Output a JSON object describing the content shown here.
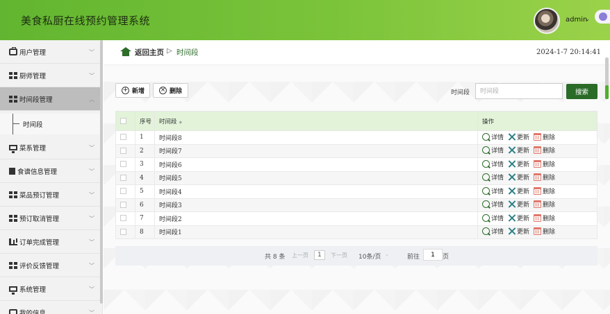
{
  "header": {
    "title": "美食私厨在线预约管理系统",
    "user_name": "admin",
    "caret": "⌄"
  },
  "sidebar": {
    "items": [
      {
        "label": "用户管理",
        "icon": "briefcase-icon",
        "expanded": false
      },
      {
        "label": "厨师管理",
        "icon": "grid-icon",
        "expanded": false
      },
      {
        "label": "时间段管理",
        "icon": "grid-icon",
        "expanded": true
      },
      {
        "label": "菜系管理",
        "icon": "monitor-icon",
        "expanded": false
      },
      {
        "label": "食谱信息管理",
        "icon": "document-icon",
        "expanded": false
      },
      {
        "label": "菜品预订管理",
        "icon": "grid-icon",
        "expanded": false
      },
      {
        "label": "预订取消管理",
        "icon": "grid-icon",
        "expanded": false
      },
      {
        "label": "订单完成管理",
        "icon": "chart-icon",
        "expanded": false
      },
      {
        "label": "评价反馈管理",
        "icon": "grid-icon",
        "expanded": false
      },
      {
        "label": "系统管理",
        "icon": "monitor-icon",
        "expanded": false
      },
      {
        "label": "我的信息",
        "icon": "user-icon",
        "expanded": false
      }
    ],
    "sub_item": "时间段"
  },
  "breadcrumb": {
    "home": "返回主页",
    "separator": "▷",
    "current": "时间段"
  },
  "datetime": "2024-1-7 20:14:41",
  "toolbar": {
    "add_label": "新增",
    "delete_label": "删除",
    "search_label": "时间段",
    "search_placeholder": "时间段",
    "search_button": "搜索"
  },
  "table": {
    "headers": [
      "序号",
      "时间段",
      "操作"
    ],
    "rows": [
      {
        "no": "1",
        "period": "时间段8"
      },
      {
        "no": "2",
        "period": "时间段7"
      },
      {
        "no": "3",
        "period": "时间段6"
      },
      {
        "no": "4",
        "period": "时间段5"
      },
      {
        "no": "5",
        "period": "时间段4"
      },
      {
        "no": "6",
        "period": "时间段3"
      },
      {
        "no": "7",
        "period": "时间段2"
      },
      {
        "no": "8",
        "period": "时间段1"
      }
    ],
    "actions": {
      "detail": "详情",
      "update": "更新",
      "delete": "删除"
    }
  },
  "pagination": {
    "total": "共 8 条",
    "prev": "上一页",
    "current_page": "1",
    "next": "下一页",
    "page_size": "10条/页",
    "goto_label": "前往",
    "goto_value": "1",
    "page_unit": "页"
  },
  "colors": {
    "header_green": "#7bc43a",
    "accent_dark_green": "#2a6b28",
    "table_header_bg": "#e2f3d9",
    "delete_red": "#e0776a"
  }
}
